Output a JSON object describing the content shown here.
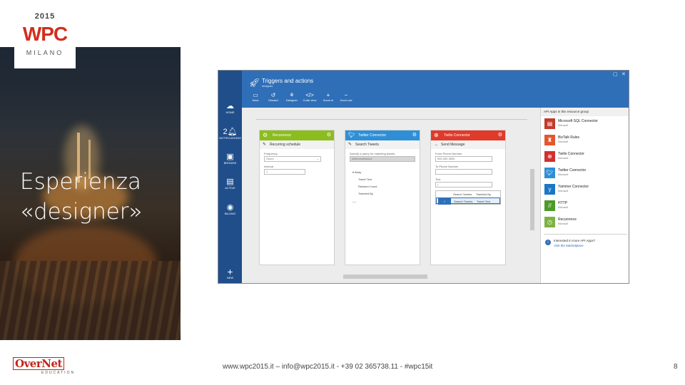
{
  "slide": {
    "logo": {
      "year": "2015",
      "brand": "WPC",
      "city": "MILANO"
    },
    "title_line1": "Esperienza",
    "title_line2": "«designer»",
    "footer": "www.wpc2015.it – info@wpc2015.it - +39 02 365738.11 - #wpc15it",
    "page_number": "8",
    "sponsor": {
      "name": "OverNet",
      "tagline": "EDUCATION"
    }
  },
  "app": {
    "left_nav": [
      {
        "icon": "cloud-icon",
        "label": "HOME"
      },
      {
        "icon": "bell-icon",
        "label": "NOTIFICATIONS",
        "badge": "2"
      },
      {
        "icon": "cube-icon",
        "label": "BROWSE"
      },
      {
        "icon": "clipboard-icon",
        "label": "ACTIVE"
      },
      {
        "icon": "billing-icon",
        "label": "BILLING"
      }
    ],
    "new_label": "NEW",
    "header": {
      "title": "Triggers and actions",
      "subtitle": "designer",
      "toolbar": [
        {
          "icon": "save-icon",
          "label": "Save"
        },
        {
          "icon": "discard-icon",
          "label": "Discard"
        },
        {
          "icon": "designer-icon",
          "label": "Designer"
        },
        {
          "icon": "code-view-icon",
          "label": "Code view"
        },
        {
          "icon": "zoom-in-icon",
          "label": "Zoom in"
        },
        {
          "icon": "zoom-out-icon",
          "label": "Zoom out"
        }
      ]
    },
    "cards": [
      {
        "title": "Recurrence",
        "color": "#8cbd1f",
        "action": "Recurring schedule",
        "fields": [
          {
            "label": "Frequency",
            "value": "Hours"
          },
          {
            "label": "Interval",
            "value": "1"
          }
        ]
      },
      {
        "title": "Twitter Connector",
        "color": "#2f8fd6",
        "action": "Search Tweets",
        "fields": [
          {
            "label": "Specify a query for matching tweets",
            "value": "#MicrosoftAzure"
          }
        ],
        "tree_root": "Body",
        "tree_items": [
          "Tweet Text",
          "Retweet Count",
          "Tweeted By"
        ],
        "more": "..."
      },
      {
        "title": "Twilio Connector",
        "color": "#e03a2a",
        "action": "Send Message",
        "fields": [
          {
            "label": "From Phone Number",
            "value": "555 555 5555"
          },
          {
            "label": "To Phone Number",
            "value": ""
          },
          {
            "label": "Text",
            "value": "|"
          }
        ],
        "options": [
          {
            "source": "Search Tweets",
            "field": "Tweeted By"
          },
          {
            "source": "Search Tweets",
            "field": "Tweet Text"
          }
        ]
      }
    ],
    "panel": {
      "header": "API Apps in this resource group",
      "publisher": "Microsoft",
      "items": [
        {
          "name": "Microsoft SQL Connector",
          "color": "#c33a2b",
          "icon": "database-icon"
        },
        {
          "name": "BizTalk Rules",
          "color": "#e4572e",
          "icon": "rules-icon"
        },
        {
          "name": "Twilio Connector",
          "color": "#d32f2f",
          "icon": "twilio-icon"
        },
        {
          "name": "Twitter Connector",
          "color": "#2f8fd6",
          "icon": "twitter-icon"
        },
        {
          "name": "Yammer Connector",
          "color": "#1b76c7",
          "icon": "yammer-icon"
        },
        {
          "name": "HTTP",
          "color": "#4c9a2a",
          "icon": "http-icon"
        },
        {
          "name": "Recurrence",
          "color": "#7cb342",
          "icon": "recurrence-icon"
        }
      ],
      "more_line1": "Interested in more API Apps?",
      "more_line2": "Visit the Marketplace"
    }
  }
}
